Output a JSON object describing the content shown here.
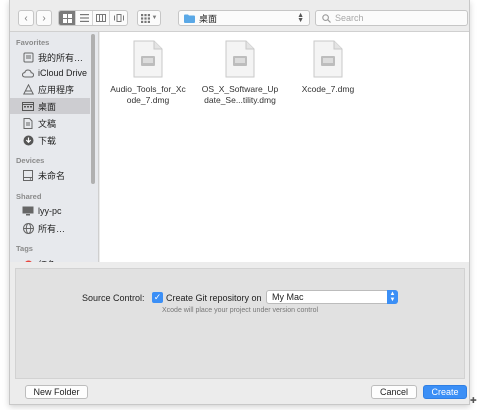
{
  "toolbar": {
    "location": "桌面",
    "search_placeholder": "Search"
  },
  "sidebar": {
    "favorites_header": "Favorites",
    "favorites": [
      {
        "label": "我的所有…",
        "icon": "all-files-icon"
      },
      {
        "label": "iCloud Drive",
        "icon": "cloud-icon"
      },
      {
        "label": "应用程序",
        "icon": "applications-icon"
      },
      {
        "label": "桌面",
        "icon": "desktop-icon",
        "selected": true
      },
      {
        "label": "文稿",
        "icon": "documents-icon"
      },
      {
        "label": "下载",
        "icon": "downloads-icon"
      }
    ],
    "devices_header": "Devices",
    "devices": [
      {
        "label": "未命名",
        "icon": "drive-icon"
      }
    ],
    "shared_header": "Shared",
    "shared": [
      {
        "label": "lyy-pc",
        "icon": "computer-icon"
      },
      {
        "label": "所有…",
        "icon": "network-icon"
      }
    ],
    "tags_header": "Tags",
    "tags": [
      {
        "label": "红色",
        "icon": "red-tag-icon",
        "color": "#e8453c"
      }
    ]
  },
  "files": [
    {
      "name": "Audio_Tools_for_Xc\node_7.dmg",
      "icon": "dmg-file-icon"
    },
    {
      "name": "OS_X_Software_Up\ndate_Se...tility.dmg",
      "icon": "dmg-file-icon"
    },
    {
      "name": "Xcode_7.dmg",
      "icon": "dmg-file-icon"
    }
  ],
  "options": {
    "source_control_label": "Source Control:",
    "checkbox_label": "Create Git repository on",
    "checkbox_checked": true,
    "select_value": "My Mac",
    "hint": "Xcode will place your project under version control"
  },
  "buttons": {
    "new_folder": "New Folder",
    "cancel": "Cancel",
    "create": "Create"
  },
  "colors": {
    "accent": "#3b8ff6",
    "tag_red": "#e8453c"
  }
}
